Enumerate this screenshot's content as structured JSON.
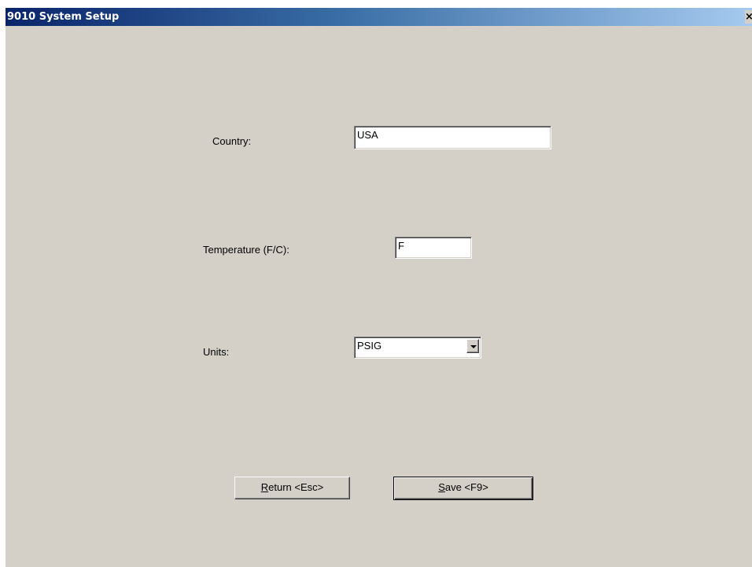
{
  "window": {
    "title": "9010 System Setup",
    "close_glyph": "×"
  },
  "form": {
    "country_label": "Country:",
    "country_value": "USA",
    "temperature_label": "Temperature (F/C):",
    "temperature_value": "F",
    "units_label": "Units:",
    "units_value": "PSIG"
  },
  "buttons": {
    "return_mnemonic": "R",
    "return_rest": "eturn <Esc>",
    "save_mnemonic": "S",
    "save_rest": "ave <F9>"
  },
  "colors": {
    "titlebar_start": "#0a246a",
    "titlebar_end": "#a6caf0",
    "face": "#d4d0c8"
  },
  "icons": {
    "close": "close-icon",
    "dropdown": "chevron-down-icon"
  }
}
